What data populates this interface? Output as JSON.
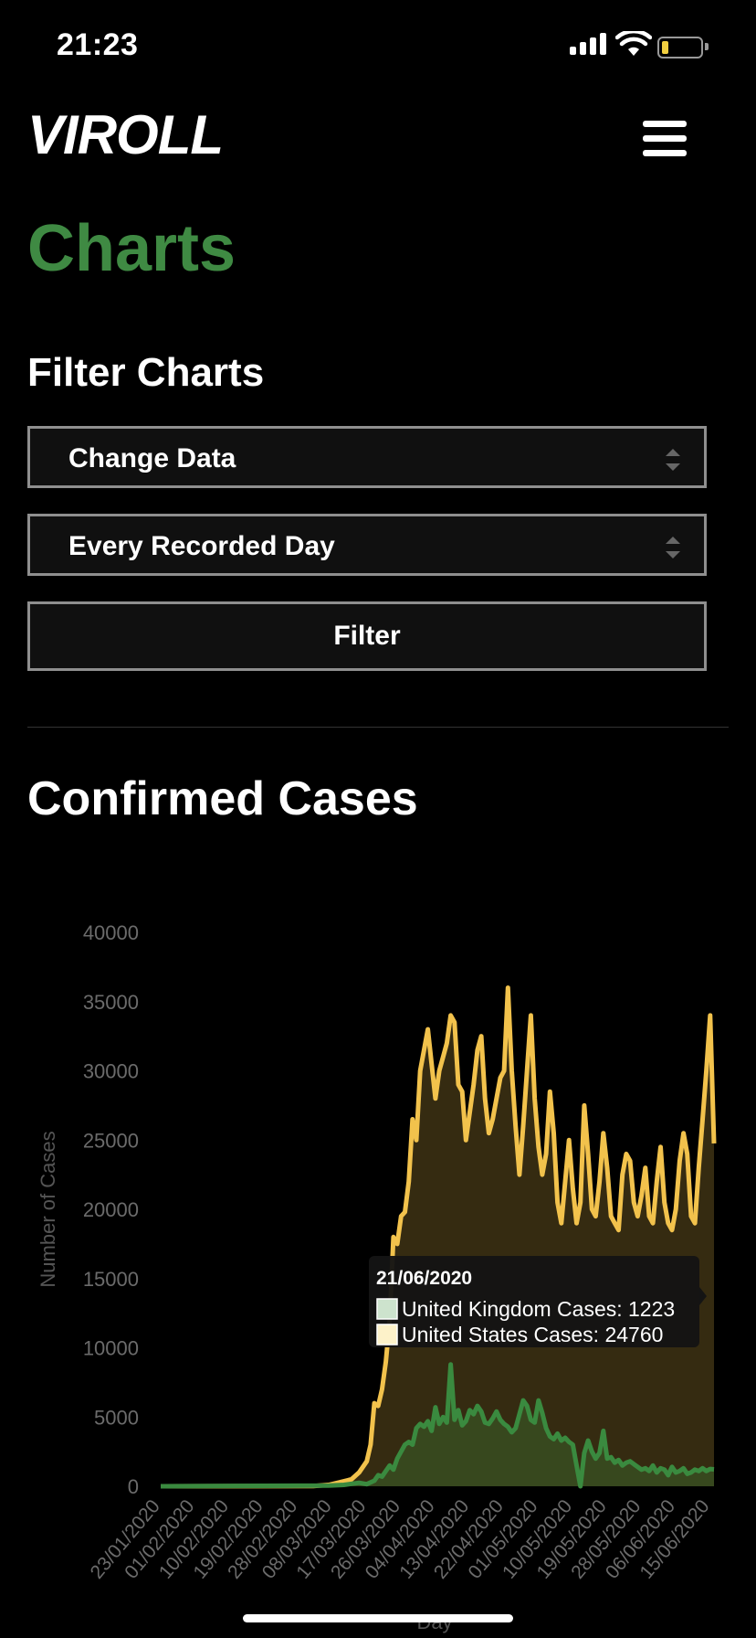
{
  "status_bar": {
    "time": "21:23"
  },
  "header": {
    "logo": "VIROLL"
  },
  "page": {
    "title": "Charts",
    "filter_heading": "Filter Charts",
    "data_select_label": "Change Data",
    "range_select_label": "Every Recorded Day",
    "filter_button_label": "Filter",
    "chart_heading": "Confirmed Cases"
  },
  "colors": {
    "accent_green": "#3f8a43",
    "us_line": "#f2c24c",
    "uk_line": "#3a8a3f"
  },
  "tooltip": {
    "date": "21/06/2020",
    "uk_text": "United Kingdom Cases: 1223",
    "us_text": "United States Cases: 24760"
  },
  "chart_data": {
    "type": "area",
    "title": "",
    "xlabel": "Day",
    "ylabel": "Number of Cases",
    "ylim": [
      0,
      40000
    ],
    "yticks": [
      0,
      5000,
      10000,
      15000,
      20000,
      25000,
      30000,
      35000,
      40000
    ],
    "x_tick_labels": [
      "23/01/2020",
      "01/02/2020",
      "10/02/2020",
      "19/02/2020",
      "28/02/2020",
      "08/03/2020",
      "17/03/2020",
      "26/03/2020",
      "04/04/2020",
      "13/04/2020",
      "22/04/2020",
      "01/05/2020",
      "10/05/2020",
      "19/05/2020",
      "28/05/2020",
      "06/06/2020",
      "15/06/2020"
    ],
    "grid": false,
    "legend": "none",
    "series": [
      {
        "name": "United States Cases",
        "color": "#f2c24c",
        "points": [
          [
            0,
            0
          ],
          [
            40,
            20
          ],
          [
            44,
            100
          ],
          [
            47,
            300
          ],
          [
            50,
            500
          ],
          [
            52,
            1000
          ],
          [
            54,
            1800
          ],
          [
            55,
            3000
          ],
          [
            56,
            6000
          ],
          [
            57,
            5800
          ],
          [
            58,
            7000
          ],
          [
            59,
            9000
          ],
          [
            60,
            12000
          ],
          [
            61,
            18000
          ],
          [
            62,
            17500
          ],
          [
            63,
            19500
          ],
          [
            64,
            19800
          ],
          [
            65,
            22000
          ],
          [
            66,
            26500
          ],
          [
            67,
            25000
          ],
          [
            68,
            30000
          ],
          [
            69,
            31500
          ],
          [
            70,
            33000
          ],
          [
            71,
            30500
          ],
          [
            72,
            28000
          ],
          [
            73,
            30000
          ],
          [
            74,
            31000
          ],
          [
            75,
            32000
          ],
          [
            76,
            34000
          ],
          [
            77,
            33500
          ],
          [
            78,
            29000
          ],
          [
            79,
            28500
          ],
          [
            80,
            25000
          ],
          [
            81,
            27000
          ],
          [
            82,
            29000
          ],
          [
            83,
            31500
          ],
          [
            84,
            32500
          ],
          [
            85,
            28000
          ],
          [
            86,
            25500
          ],
          [
            87,
            26500
          ],
          [
            88,
            28000
          ],
          [
            89,
            29500
          ],
          [
            90,
            30000
          ],
          [
            91,
            36000
          ],
          [
            92,
            30000
          ],
          [
            93,
            26000
          ],
          [
            94,
            22500
          ],
          [
            95,
            26000
          ],
          [
            96,
            30000
          ],
          [
            97,
            34000
          ],
          [
            98,
            28000
          ],
          [
            99,
            24500
          ],
          [
            100,
            22500
          ],
          [
            101,
            24000
          ],
          [
            102,
            28500
          ],
          [
            103,
            25500
          ],
          [
            104,
            20500
          ],
          [
            105,
            19000
          ],
          [
            106,
            22000
          ],
          [
            107,
            25000
          ],
          [
            108,
            21500
          ],
          [
            109,
            19000
          ],
          [
            110,
            20500
          ],
          [
            111,
            27500
          ],
          [
            112,
            24000
          ],
          [
            113,
            20000
          ],
          [
            114,
            19500
          ],
          [
            115,
            22000
          ],
          [
            116,
            25500
          ],
          [
            117,
            23000
          ],
          [
            118,
            19500
          ],
          [
            119,
            19000
          ],
          [
            120,
            18500
          ],
          [
            121,
            22500
          ],
          [
            122,
            24000
          ],
          [
            123,
            23500
          ],
          [
            124,
            20500
          ],
          [
            125,
            19500
          ],
          [
            126,
            21000
          ],
          [
            127,
            23000
          ],
          [
            128,
            19500
          ],
          [
            129,
            19000
          ],
          [
            130,
            22000
          ],
          [
            131,
            24500
          ],
          [
            132,
            20500
          ],
          [
            133,
            19000
          ],
          [
            134,
            18500
          ],
          [
            135,
            20000
          ],
          [
            136,
            23500
          ],
          [
            137,
            25500
          ],
          [
            138,
            24000
          ],
          [
            139,
            19500
          ],
          [
            140,
            19000
          ],
          [
            141,
            23000
          ],
          [
            142,
            26500
          ],
          [
            143,
            30000
          ],
          [
            144,
            34000
          ],
          [
            145,
            24760
          ]
        ]
      },
      {
        "name": "United Kingdom Cases",
        "color": "#3a8a3f",
        "points": [
          [
            0,
            0
          ],
          [
            44,
            50
          ],
          [
            48,
            100
          ],
          [
            52,
            250
          ],
          [
            54,
            150
          ],
          [
            56,
            400
          ],
          [
            57,
            800
          ],
          [
            58,
            700
          ],
          [
            59,
            1100
          ],
          [
            60,
            1500
          ],
          [
            61,
            1200
          ],
          [
            62,
            2000
          ],
          [
            63,
            2500
          ],
          [
            64,
            3000
          ],
          [
            65,
            3200
          ],
          [
            66,
            3000
          ],
          [
            67,
            4200
          ],
          [
            68,
            4500
          ],
          [
            69,
            4300
          ],
          [
            70,
            4700
          ],
          [
            71,
            4000
          ],
          [
            72,
            5700
          ],
          [
            73,
            4500
          ],
          [
            74,
            5000
          ],
          [
            75,
            4600
          ],
          [
            76,
            8800
          ],
          [
            77,
            4800
          ],
          [
            78,
            5500
          ],
          [
            79,
            4400
          ],
          [
            80,
            4700
          ],
          [
            81,
            5500
          ],
          [
            82,
            5200
          ],
          [
            83,
            5800
          ],
          [
            84,
            5400
          ],
          [
            85,
            4600
          ],
          [
            86,
            4500
          ],
          [
            87,
            4900
          ],
          [
            88,
            5400
          ],
          [
            89,
            4800
          ],
          [
            90,
            4500
          ],
          [
            91,
            4300
          ],
          [
            92,
            3900
          ],
          [
            93,
            4200
          ],
          [
            94,
            5200
          ],
          [
            95,
            6200
          ],
          [
            96,
            5800
          ],
          [
            97,
            4800
          ],
          [
            98,
            4600
          ],
          [
            99,
            6200
          ],
          [
            100,
            5300
          ],
          [
            101,
            4200
          ],
          [
            102,
            3600
          ],
          [
            103,
            3400
          ],
          [
            104,
            3800
          ],
          [
            105,
            3300
          ],
          [
            106,
            3500
          ],
          [
            107,
            3200
          ],
          [
            108,
            3000
          ],
          [
            109,
            1500
          ],
          [
            110,
            0
          ],
          [
            111,
            2400
          ],
          [
            112,
            3300
          ],
          [
            113,
            2500
          ],
          [
            114,
            2000
          ],
          [
            115,
            2400
          ],
          [
            116,
            4000
          ],
          [
            117,
            2000
          ],
          [
            118,
            2100
          ],
          [
            119,
            1700
          ],
          [
            120,
            1900
          ],
          [
            121,
            1500
          ],
          [
            122,
            1700
          ],
          [
            123,
            1800
          ],
          [
            124,
            1600
          ],
          [
            125,
            1400
          ],
          [
            126,
            1200
          ],
          [
            127,
            1300
          ],
          [
            128,
            1100
          ],
          [
            129,
            1500
          ],
          [
            130,
            1000
          ],
          [
            131,
            1300
          ],
          [
            132,
            1200
          ],
          [
            133,
            800
          ],
          [
            134,
            1400
          ],
          [
            135,
            1000
          ],
          [
            136,
            1100
          ],
          [
            137,
            1300
          ],
          [
            138,
            900
          ],
          [
            139,
            1000
          ],
          [
            140,
            1200
          ],
          [
            141,
            1100
          ],
          [
            142,
            1300
          ],
          [
            143,
            1100
          ],
          [
            144,
            1250
          ],
          [
            145,
            1223
          ]
        ]
      }
    ]
  }
}
